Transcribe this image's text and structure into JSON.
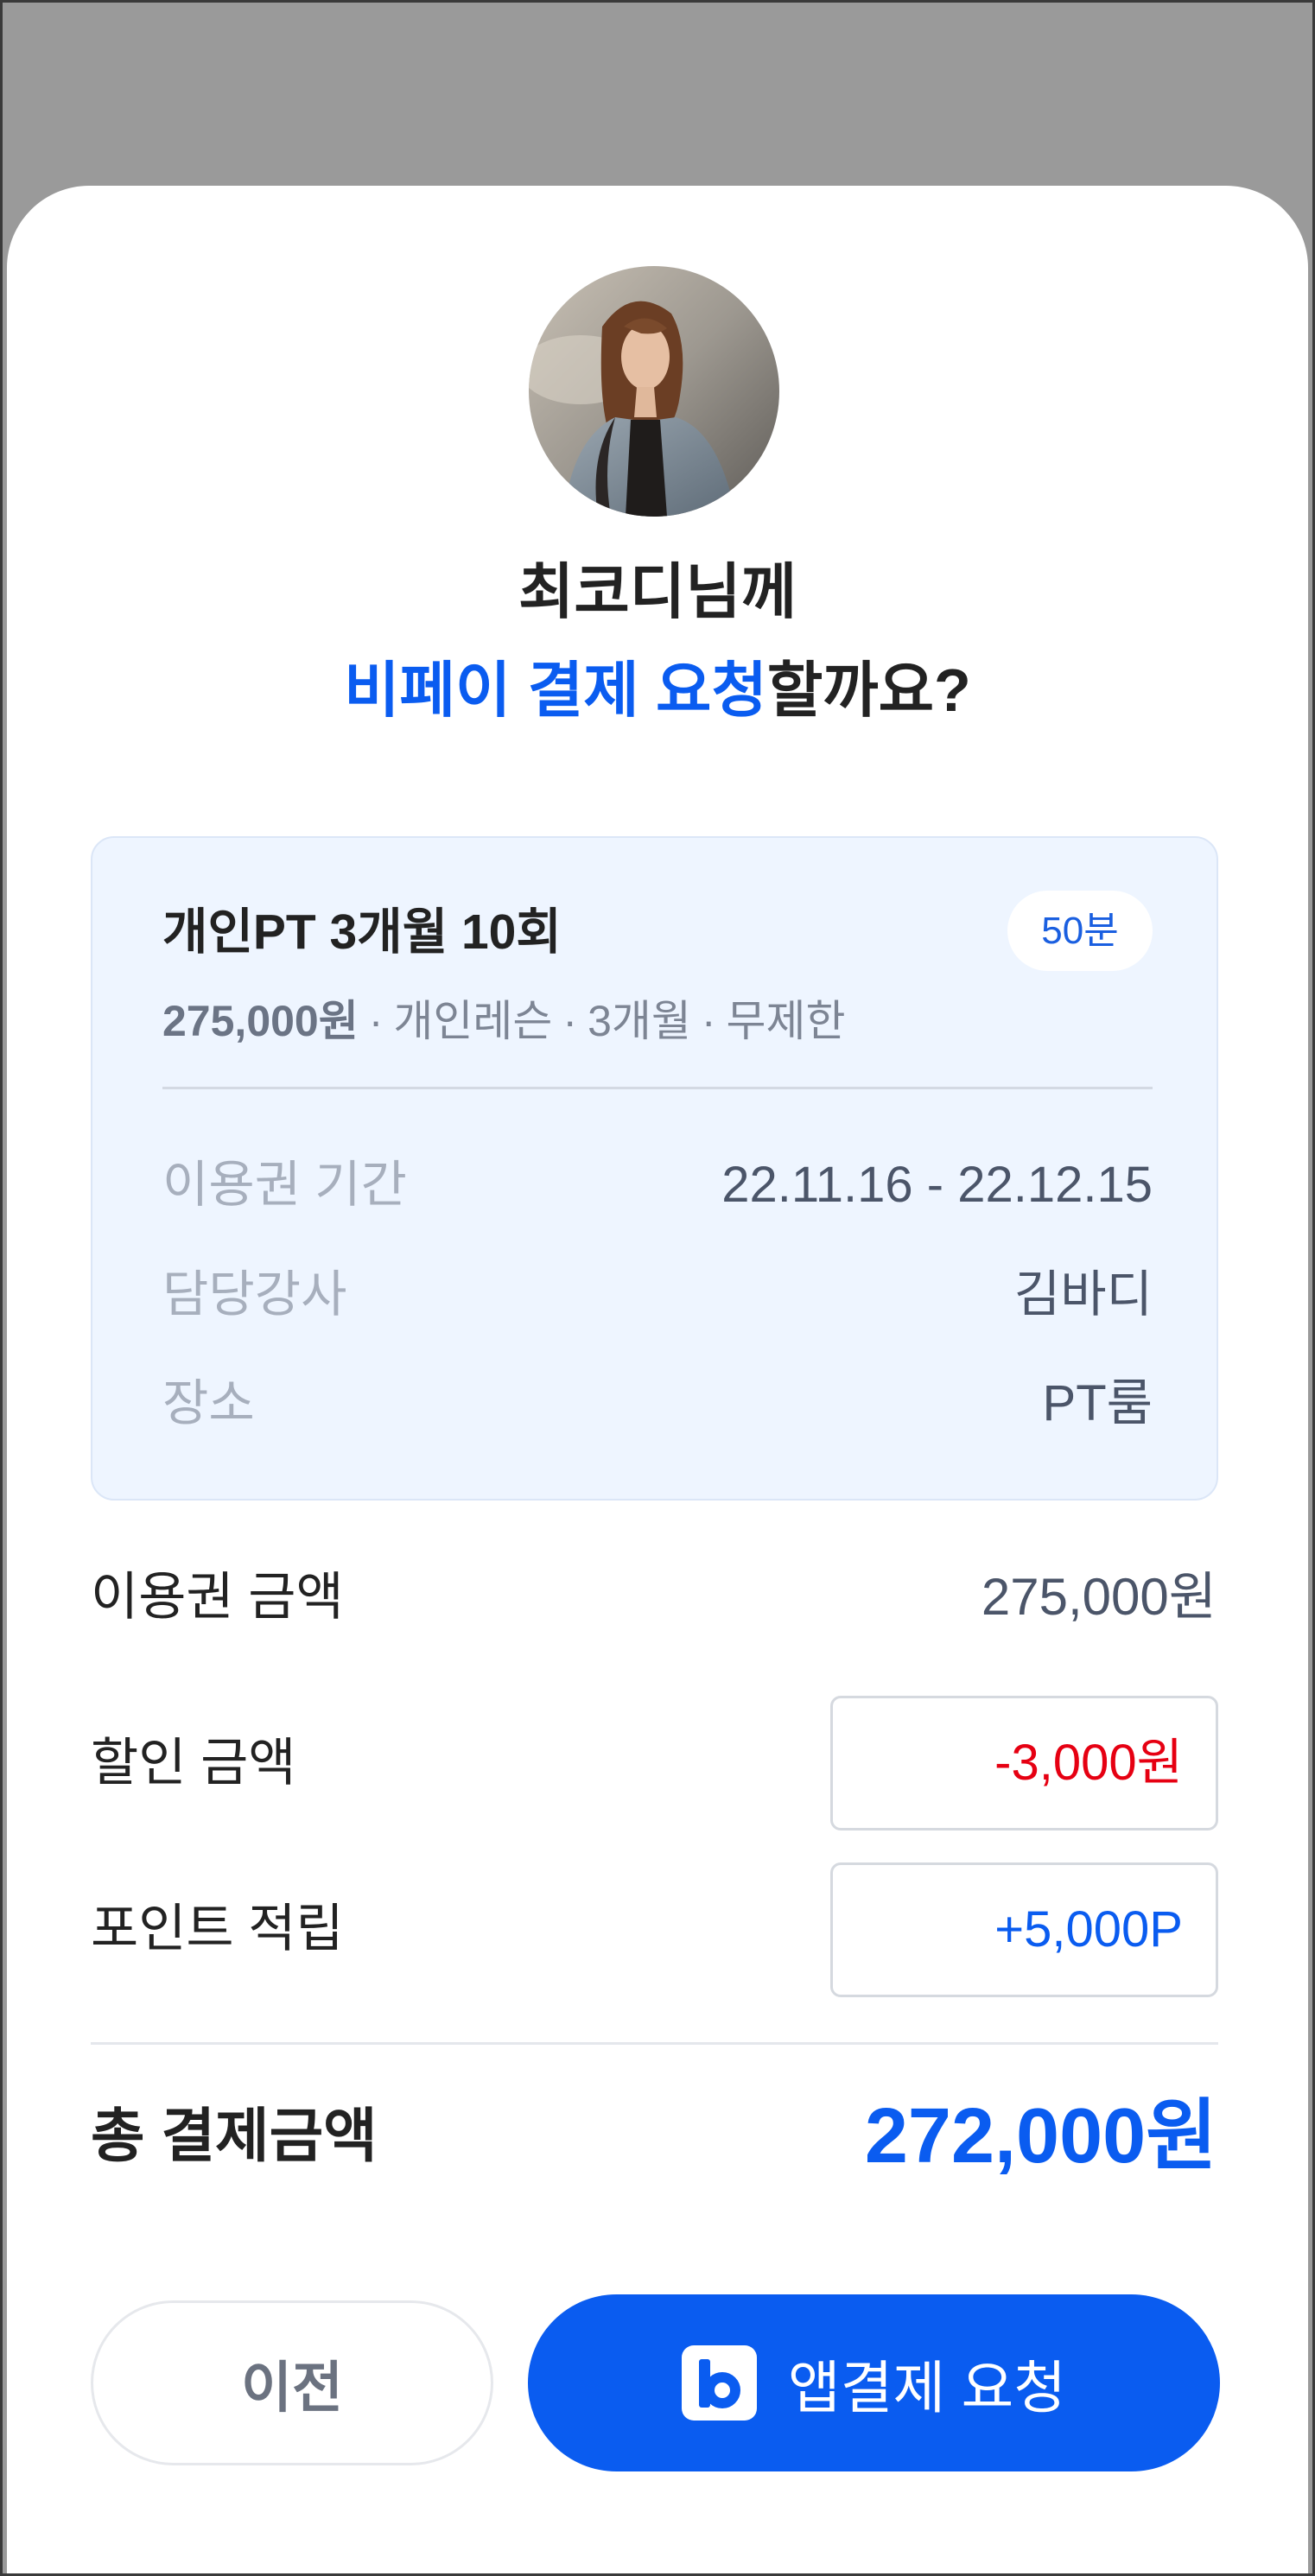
{
  "request_prompt": {
    "recipient_line": "최코디님께",
    "question_highlight": "비페이 결제 요청",
    "question_rest": "할까요?"
  },
  "pass": {
    "title": "개인PT 3개월 10회",
    "duration_badge": "50분",
    "price": "275,000원",
    "separator": "·",
    "meta": [
      "개인레슨",
      "3개월",
      "무제한"
    ],
    "details": [
      {
        "label": "이용권 기간",
        "value": "22.11.16 - 22.12.15"
      },
      {
        "label": "담당강사",
        "value": "김바디"
      },
      {
        "label": "장소",
        "value": "PT룸"
      }
    ]
  },
  "summary": {
    "pass_amount_label": "이용권 금액",
    "pass_amount_value": "275,000원",
    "discount_label": "할인 금액",
    "discount_value": "-3,000원",
    "points_label": "포인트 적립",
    "points_value": "+5,000P",
    "total_label": "총 결제금액",
    "total_value": "272,000원"
  },
  "actions": {
    "prev_label": "이전",
    "request_label": "앱결제 요청",
    "request_icon": "bpay-logo-icon"
  },
  "avatar": {
    "icon": "profile-photo"
  },
  "colors": {
    "accent": "#0a5cf0",
    "discount": "#e60012",
    "overlay": "#9a9a9a"
  }
}
